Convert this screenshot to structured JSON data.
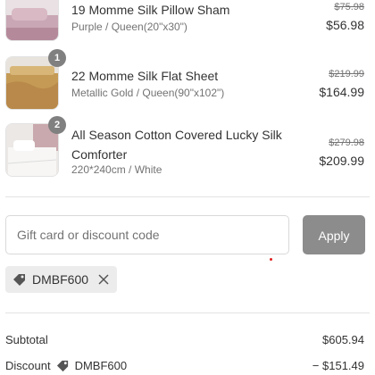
{
  "items": [
    {
      "name": "19 Momme Silk Pillow Sham",
      "variant": "Purple / Queen(20\"x30\")",
      "compare_price": "$75.98",
      "price": "$56.98",
      "quantity": "",
      "image_icon": "pillow-sham-image"
    },
    {
      "name": "22 Momme Silk Flat Sheet",
      "variant": "Metallic Gold / Queen(90\"x102\")",
      "compare_price": "$219.99",
      "price": "$164.99",
      "quantity": "1",
      "image_icon": "flat-sheet-image"
    },
    {
      "name": "All Season Cotton Covered Lucky Silk Comforter",
      "variant": "220*240cm / White",
      "compare_price": "$279.98",
      "price": "$209.99",
      "quantity": "2",
      "image_icon": "comforter-image"
    }
  ],
  "discount": {
    "placeholder": "Gift card or discount code",
    "apply_label": "Apply",
    "applied_code": "DMBF600"
  },
  "summary": {
    "subtotal_label": "Subtotal",
    "subtotal_value": "$605.94",
    "discount_label": "Discount",
    "discount_code": "DMBF600",
    "discount_value": "− $151.49"
  },
  "colors": {
    "apply_button": "#8c8c8c",
    "chip_background": "#ececec",
    "muted_text": "#737373"
  }
}
